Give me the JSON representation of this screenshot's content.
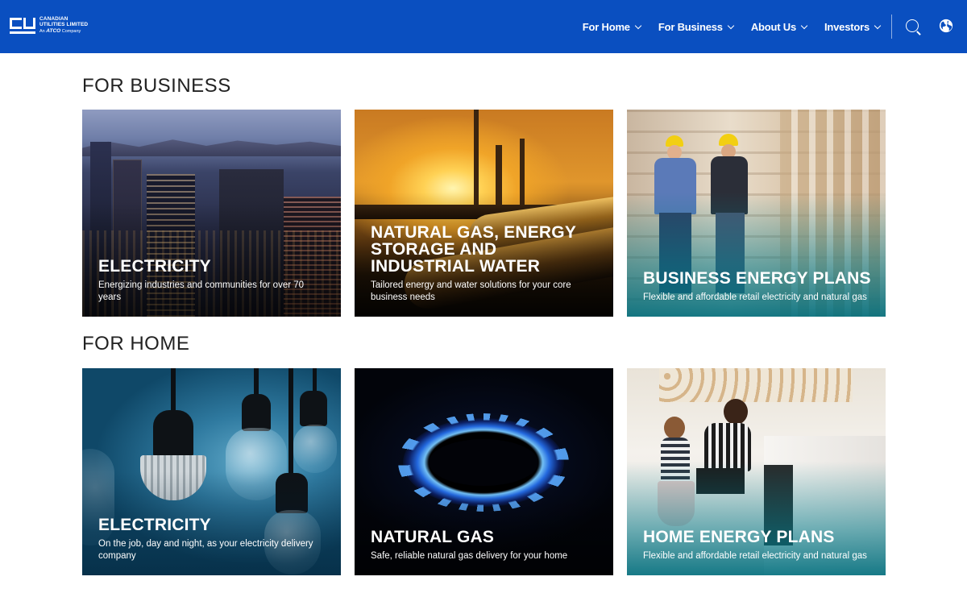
{
  "header": {
    "logo": {
      "line1": "CANADIAN",
      "line2": "UTILITIES LIMITED",
      "line3_prefix": "An",
      "line3_brand": "ATCO",
      "line3_suffix": "Company"
    },
    "nav": [
      {
        "label": "For Home"
      },
      {
        "label": "For Business"
      },
      {
        "label": "About Us"
      },
      {
        "label": "Investors"
      }
    ],
    "icons": [
      "search-icon",
      "globe-icon"
    ],
    "color": "#0a4fc0"
  },
  "sections": {
    "business": {
      "title": "FOR BUSINESS",
      "cards": [
        {
          "title": "ELECTRICITY",
          "desc": "Energizing industries and communities for over 70 years"
        },
        {
          "title": "NATURAL GAS, ENERGY STORAGE AND INDUSTRIAL WATER",
          "desc": "Tailored energy and water solutions for your core business needs"
        },
        {
          "title": "BUSINESS ENERGY PLANS",
          "desc": "Flexible and affordable retail electricity and natural gas"
        }
      ]
    },
    "home": {
      "title": "FOR HOME",
      "cards": [
        {
          "title": "ELECTRICITY",
          "desc": "On the job, day and night, as your electricity delivery company"
        },
        {
          "title": "NATURAL GAS",
          "desc": "Safe, reliable natural gas delivery for your home"
        },
        {
          "title": "HOME ENERGY PLANS",
          "desc": "Flexible and affordable retail electricity and natural gas"
        }
      ]
    }
  }
}
